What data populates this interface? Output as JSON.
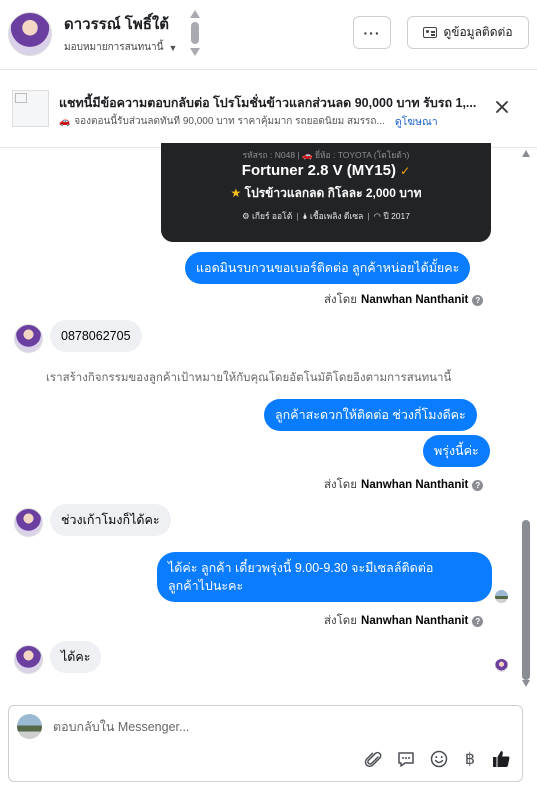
{
  "header": {
    "name": "ดาวรรณ์ โพธิ์ใต้",
    "assignment": "มอบหมายการสนทนานี้",
    "more_label": "···",
    "contact_button": "ดูข้อมูลติดต่อ"
  },
  "ad": {
    "title": "แชทนี้มีข้อความตอบกลับต่อ โปรโมชั่นข้าวแลกส่วนลด 90,000 บาท รับรถ 1,...",
    "description": "จองตอนนี้รับส่วนลดทันที 90,000 บาท ราคาคุ้มมาก รถยอดนิยม สมรรถ...",
    "link": "ดูโฆษณา"
  },
  "card": {
    "meta": "รหัสรถ : N048 | 🚗 ยี่ห้อ : TOYOTA (โตโยต้า)",
    "model": "Fortuner 2.8 V (MY15)",
    "promo": "โปรข้าวแลกลด กิโลละ 2,000 บาท",
    "spec_gear": "⚙ เกียร์ ออโต้",
    "spec_fuel": "🌢 เชื้อเพลิง ดีเซล",
    "spec_year": "◠ ปี 2017"
  },
  "messages": {
    "out1": "แอดมินรบกวนขอเบอร์ติดต่อ ลูกค้าหน่อยได้มั้ยคะ",
    "sent_prefix": "ส่งโดย",
    "sender": "Nanwhan Nanthanit",
    "in1": "0878062705",
    "system_note": "เราสร้างกิจกรรมของลูกค้าเป้าหมายให้กับคุณโดยอัตโนมัติโดยอิงตามการสนทนานี้",
    "out2": "ลูกค้าสะดวกให้ติดต่อ ช่วงกี่โมงดีคะ",
    "out3": "พรุ่งนี้ค่ะ",
    "in2": "ช่วงเก้าโมงก็ได้คะ",
    "out4_line1": "ได้ค่ะ  ลูกค้า  เดี๋ยวพรุ่งนี้ 9.00-9.30 จะมีเซลล์ติดต่อ",
    "out4_line2": "ลูกค้าไปนะคะ",
    "in3": "ได้คะ"
  },
  "composer": {
    "placeholder": "ตอบกลับใน Messenger..."
  },
  "icons": {
    "attach": "paperclip-icon",
    "saved_replies": "speech-bubble-icon",
    "emoji": "smiley-icon",
    "currency": "baht-icon",
    "like": "thumbs-up-icon"
  },
  "colors": {
    "outgoing_bubble": "#0a7cff",
    "incoming_bubble": "#eef0f3",
    "link": "#1a62c6"
  }
}
